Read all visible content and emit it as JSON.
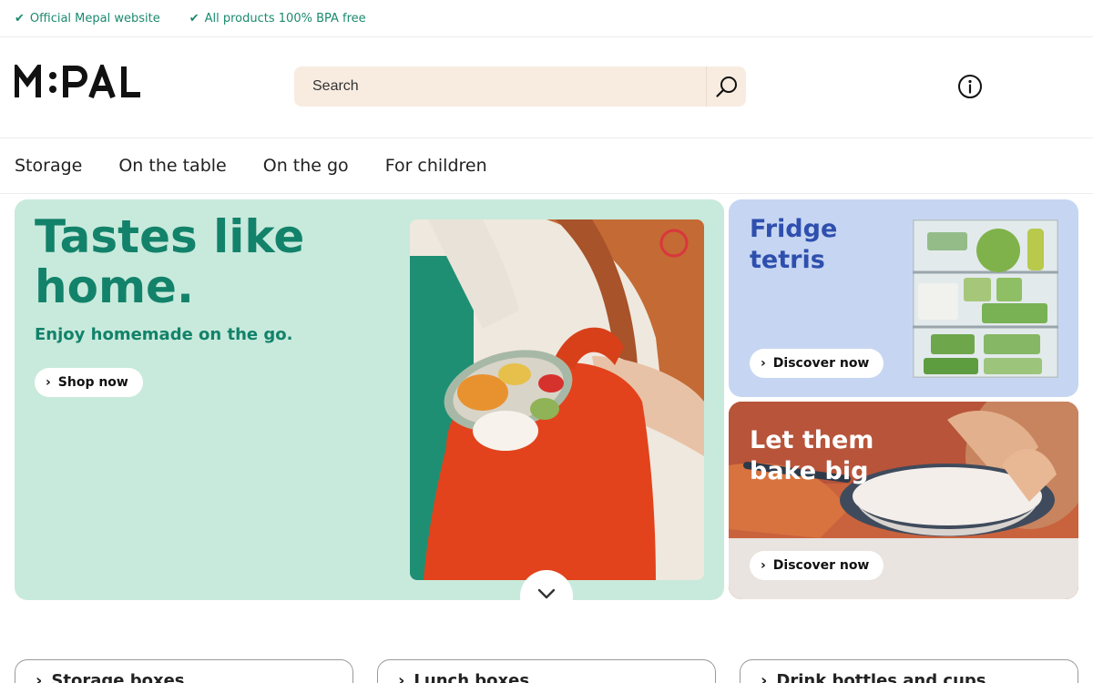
{
  "usp_bar": {
    "items": [
      {
        "label": "Official Mepal website",
        "icon": "check-icon"
      },
      {
        "label": "All products 100% BPA free",
        "icon": "check-icon"
      }
    ],
    "accent_color": "#1b8a6f"
  },
  "header": {
    "logo_text": "MEPAL",
    "search": {
      "placeholder": "Search",
      "icon": "search-icon"
    },
    "info_icon": "info-icon"
  },
  "nav": {
    "items": [
      {
        "label": "Storage"
      },
      {
        "label": "On the table"
      },
      {
        "label": "On the go"
      },
      {
        "label": "For children"
      }
    ]
  },
  "hero": {
    "title": "Tastes like home.",
    "subtitle": "Enjoy homemade on the go.",
    "cta_label": "Shop now",
    "background": "#c8eadc",
    "text_color": "#13826a"
  },
  "tiles": [
    {
      "title": "Fridge tetris",
      "cta_label": "Discover now",
      "background": "#c6d6f2",
      "title_color": "#2f4fae"
    },
    {
      "title": "Let them bake big",
      "cta_label": "Discover now",
      "background": "#c9633e",
      "title_color": "#ffffff"
    }
  ],
  "categories": [
    {
      "label": "Storage boxes"
    },
    {
      "label": "Lunch boxes"
    },
    {
      "label": "Drink bottles and cups"
    }
  ]
}
